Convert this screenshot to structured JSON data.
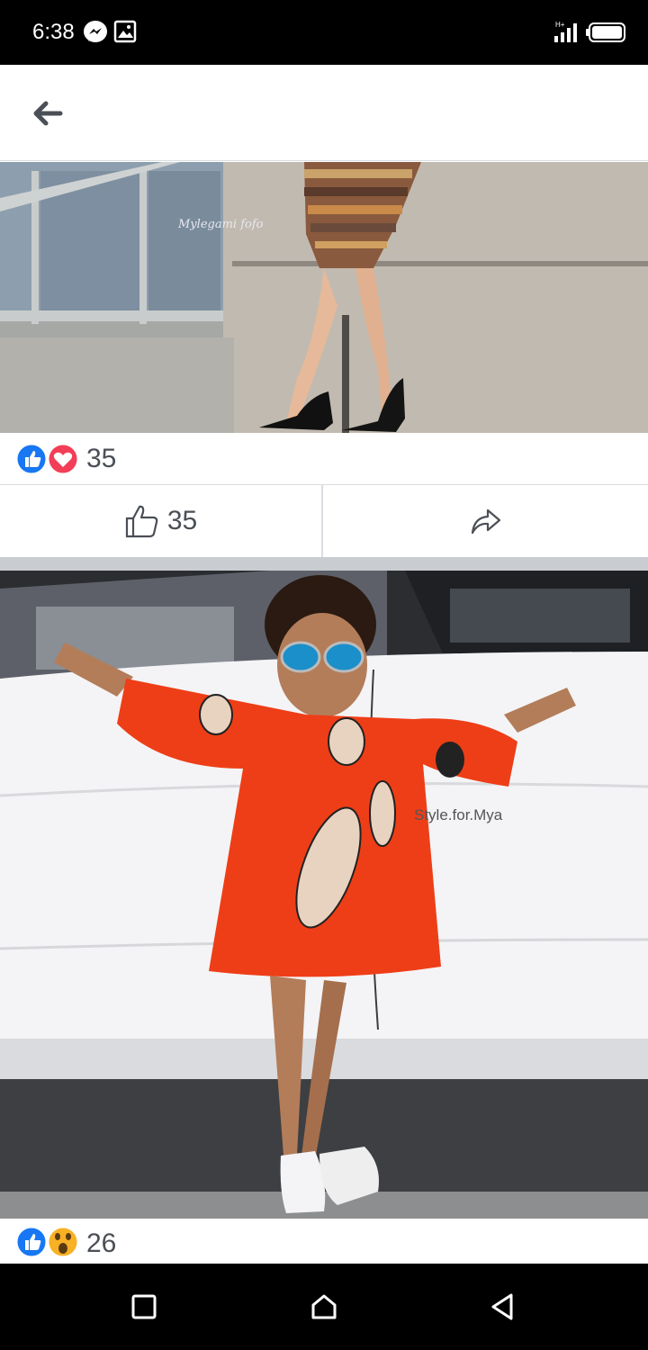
{
  "status_bar": {
    "time": "6:38"
  },
  "header": {
    "back_icon": "arrow-left-icon"
  },
  "post1": {
    "photo_watermark": "Mylegami fofo",
    "reaction_icons": [
      "like-icon",
      "love-icon"
    ],
    "reaction_count": "35",
    "like_count": "35"
  },
  "post2": {
    "photo_watermark": "Style.for.Mya",
    "reaction_icons": [
      "like-icon",
      "wow-icon"
    ],
    "reaction_count": "26"
  },
  "colors": {
    "like_blue": "#1877f2",
    "love_red": "#f33e58",
    "wow_yellow": "#f7b125",
    "text_grey": "#4b4f56"
  }
}
